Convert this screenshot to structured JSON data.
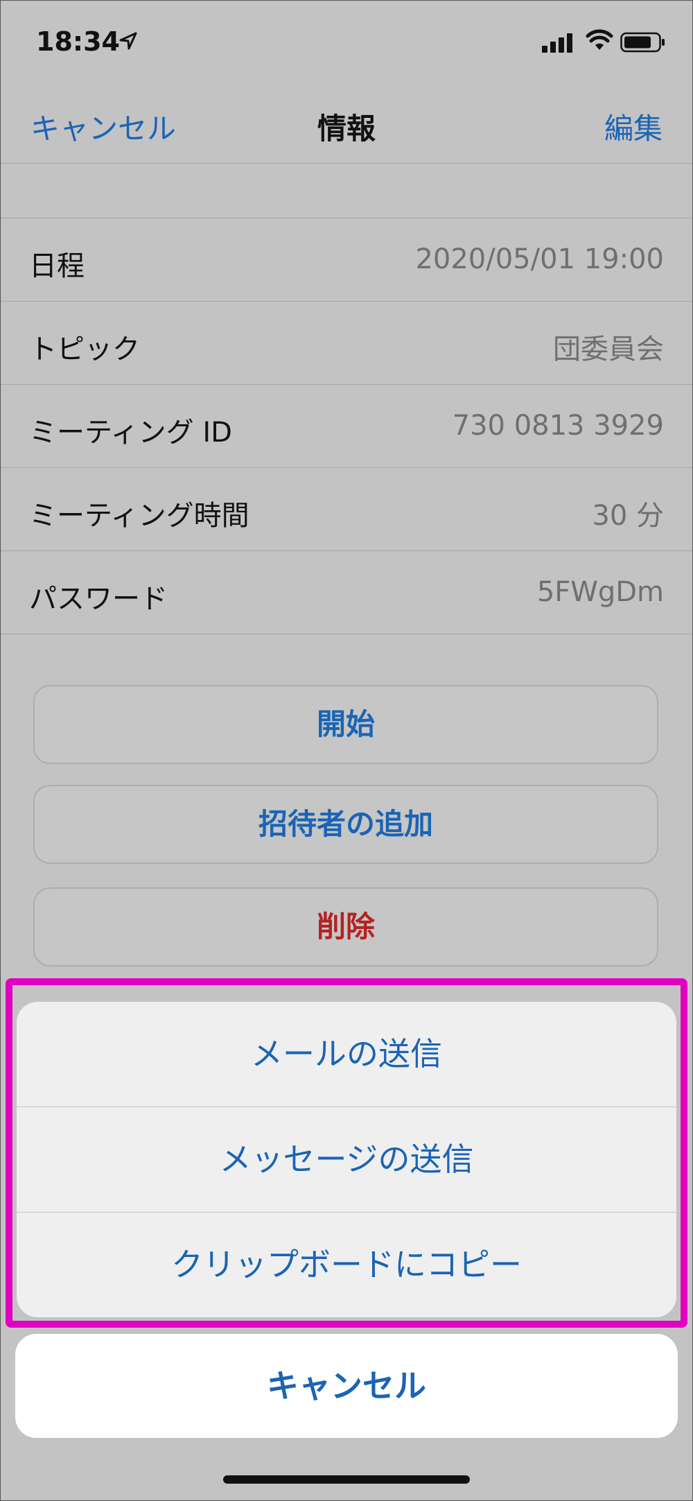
{
  "status": {
    "time": "18:34"
  },
  "nav": {
    "cancel": "キャンセル",
    "title": "情報",
    "edit": "編集"
  },
  "info": [
    {
      "label": "日程",
      "value": "2020/05/01 19:00"
    },
    {
      "label": "トピック",
      "value": "団委員会"
    },
    {
      "label": "ミーティング ID",
      "value": "730 0813 3929"
    },
    {
      "label": "ミーティング時間",
      "value": "30 分"
    },
    {
      "label": "パスワード",
      "value": "5FWgDm"
    }
  ],
  "buttons": {
    "start": "開始",
    "invite": "招待者の追加",
    "delete": "削除"
  },
  "sheet": {
    "items": [
      "メールの送信",
      "メッセージの送信",
      "クリップボードにコピー"
    ],
    "cancel": "キャンセル"
  },
  "colors": {
    "accent": "#1a64b4",
    "danger": "#b42222",
    "highlight": "#e000c0"
  }
}
